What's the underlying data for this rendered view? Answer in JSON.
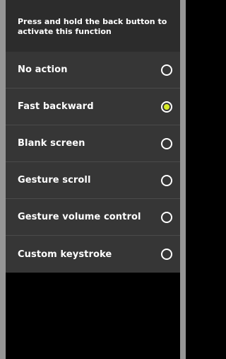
{
  "header": {
    "instruction": "Press and hold the back button to activate this function"
  },
  "options": [
    {
      "label": "No action",
      "selected": false
    },
    {
      "label": "Fast backward",
      "selected": true
    },
    {
      "label": "Blank screen",
      "selected": false
    },
    {
      "label": "Gesture scroll",
      "selected": false
    },
    {
      "label": "Gesture volume control",
      "selected": false
    },
    {
      "label": "Custom keystroke",
      "selected": false
    }
  ],
  "colors": {
    "accent": "#d6ea26",
    "panel": "#363636",
    "header": "#2c2c2c",
    "frame": "#969696"
  }
}
